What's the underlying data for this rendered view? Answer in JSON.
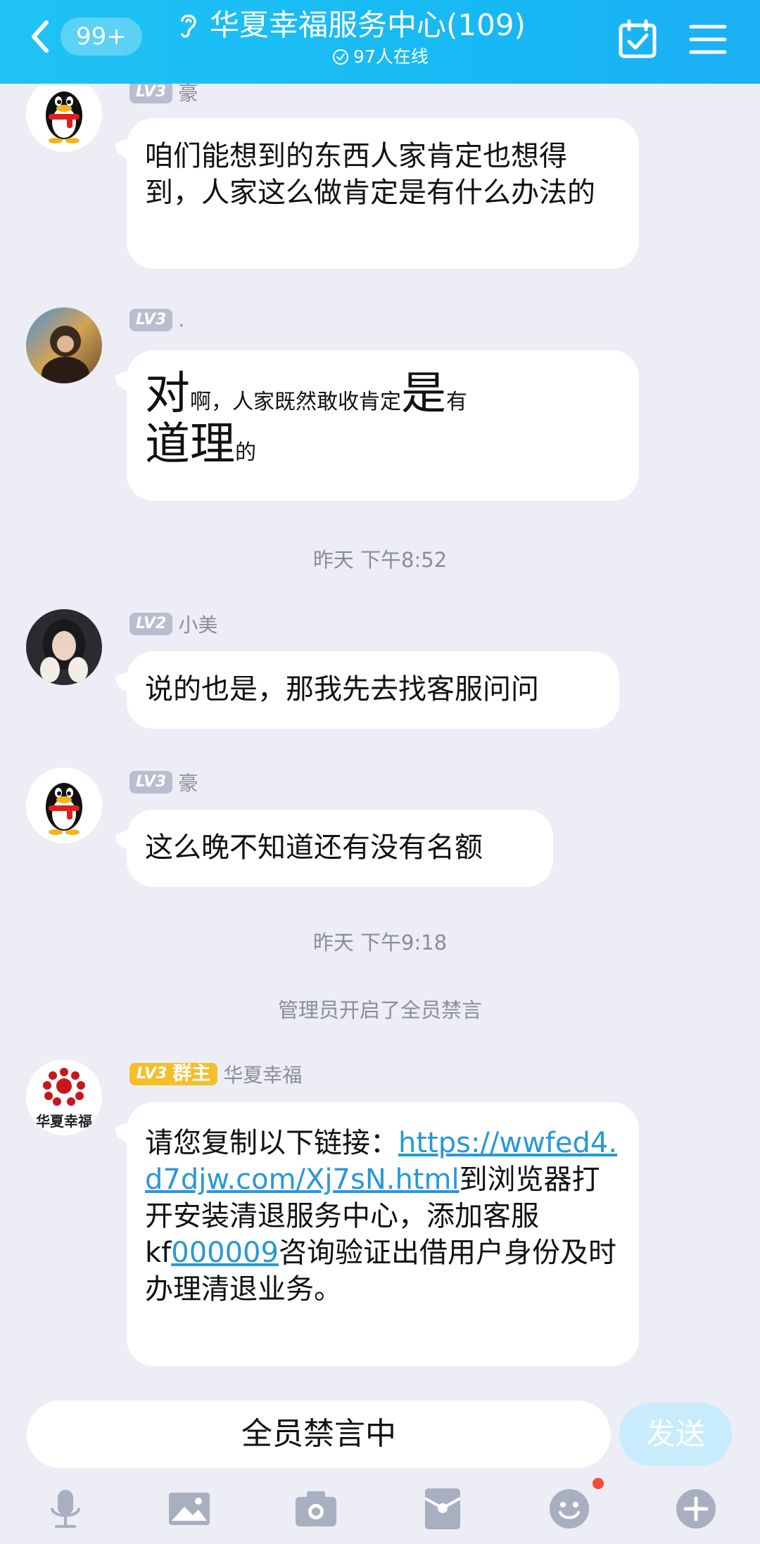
{
  "header": {
    "back_badge": "99+",
    "title": "华夏幸福服务中心(109)",
    "online": "97人在线"
  },
  "messages": [
    {
      "level": "LV3",
      "nick": "豪",
      "text": "咱们能想到的东西人家肯定也想得到，人家这么做肯定是有什么办法的"
    },
    {
      "level": "LV3",
      "nick": ".",
      "parts": [
        "对",
        "啊，人家既然敢收肯定",
        "是",
        "有",
        "道理",
        "的"
      ]
    },
    {
      "level": "LV2",
      "nick": "小美",
      "text": "说的也是，那我先去找客服问问"
    },
    {
      "level": "LV3",
      "nick": "豪",
      "text": "这么晚不知道还有没有名额"
    },
    {
      "level": "LV3",
      "role": "群主",
      "nick": "华夏幸福",
      "avatar_text": "华夏幸福",
      "text_a": "请您复制以下链接：",
      "link": "https://wwfed4.d7djw.com/Xj7sN.html",
      "text_b": "到浏览器打开安装清退服务中心，添加客服kf",
      "kf_id": "000009",
      "text_c": "咨询验证出借用户身份及时办理清退业务。"
    }
  ],
  "timestamps": [
    "昨天 下午8:52",
    "昨天 下午9:18"
  ],
  "system_notice": "管理员开启了全员禁言",
  "input": {
    "placeholder": "全员禁言中",
    "send_label": "发送"
  },
  "toolbar_icons": [
    "mic-icon",
    "image-icon",
    "camera-icon",
    "red-packet-icon",
    "emoji-icon",
    "plus-icon"
  ],
  "colors": {
    "header": "#1ec3f3",
    "background": "#ecedf5",
    "link": "#2798d8",
    "owner_badge": "#f5bf29"
  }
}
